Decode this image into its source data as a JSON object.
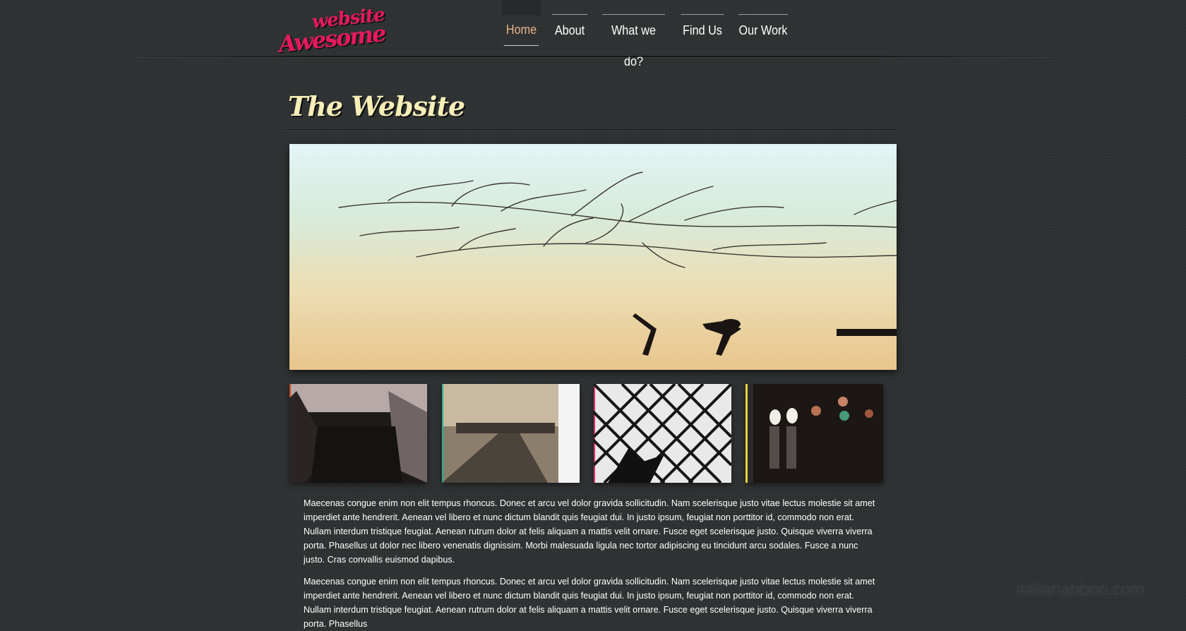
{
  "logo": {
    "line1": "website",
    "line2": "Awesome"
  },
  "nav": {
    "items": [
      {
        "label": "Home",
        "active": true
      },
      {
        "label": "About",
        "active": false
      },
      {
        "label": "What we do?",
        "active": false
      },
      {
        "label": "Find Us",
        "active": false
      },
      {
        "label": "Our Work",
        "active": false
      }
    ]
  },
  "page": {
    "title": "The Website"
  },
  "thumbnails": [
    {
      "accent": "#d2491e"
    },
    {
      "accent": "#27b58f"
    },
    {
      "accent": "#e0305e"
    },
    {
      "accent": "#e9d33b"
    }
  ],
  "content": {
    "paragraphs": [
      "Maecenas congue enim non elit tempus rhoncus. Donec et arcu vel dolor gravida sollicitudin. Nam scelerisque justo vitae lectus molestie sit amet imperdiet ante hendrerit. Aenean vel libero et nunc dictum blandit quis feugiat dui. In justo ipsum, feugiat non porttitor id, commodo non erat. Nullam interdum tristique feugiat. Aenean rutrum dolor at felis aliquam a mattis velit ornare. Fusce eget scelerisque justo. Quisque viverra viverra porta. Phasellus ut dolor nec libero venenatis dignissim. Morbi malesuada ligula nec tortor adipiscing eu tincidunt arcu sodales. Fusce a nunc justo. Cras convallis euismod dapibus.",
      "Maecenas congue enim non elit tempus rhoncus. Donec et arcu vel dolor gravida sollicitudin. Nam scelerisque justo vitae lectus molestie sit amet imperdiet ante hendrerit. Aenean vel libero et nunc dictum blandit quis feugiat dui. In justo ipsum, feugiat non porttitor id, commodo non erat. Nullam interdum tristique feugiat. Aenean rutrum dolor at felis aliquam a mattis velit ornare. Fusce eget scelerisque justo. Quisque viverra viverra porta. Phasellus"
    ]
  },
  "watermark": "italianabboo.com"
}
